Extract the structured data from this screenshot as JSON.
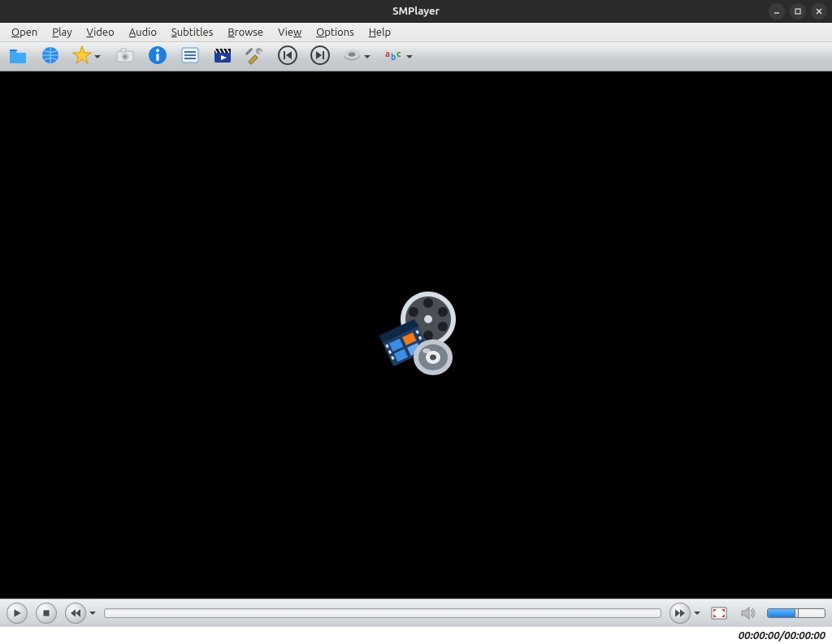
{
  "window": {
    "title": "SMPlayer"
  },
  "menu": {
    "items": [
      {
        "label": "Open",
        "mnemonic_index": 0
      },
      {
        "label": "Play",
        "mnemonic_index": 0
      },
      {
        "label": "Video",
        "mnemonic_index": 0
      },
      {
        "label": "Audio",
        "mnemonic_index": 0
      },
      {
        "label": "Subtitles",
        "mnemonic_index": 0
      },
      {
        "label": "Browse",
        "mnemonic_index": 0
      },
      {
        "label": "View",
        "mnemonic_index": 3
      },
      {
        "label": "Options",
        "mnemonic_index": 0
      },
      {
        "label": "Help",
        "mnemonic_index": 0
      }
    ]
  },
  "toolbar": {
    "buttons": [
      {
        "name": "open-file",
        "icon": "folder",
        "dropdown": false
      },
      {
        "name": "open-url",
        "icon": "globe",
        "dropdown": false
      },
      {
        "name": "favorites",
        "icon": "star",
        "dropdown": true
      },
      {
        "name": "screenshot",
        "icon": "camera",
        "dropdown": false
      },
      {
        "name": "media-info",
        "icon": "info",
        "dropdown": false
      },
      {
        "name": "show-playlist",
        "icon": "playlist",
        "dropdown": false
      },
      {
        "name": "youtube-browser",
        "icon": "clapboard",
        "dropdown": false
      },
      {
        "name": "preferences",
        "icon": "tools",
        "dropdown": false
      },
      {
        "name": "previous",
        "icon": "prev",
        "dropdown": false
      },
      {
        "name": "next",
        "icon": "next",
        "dropdown": false
      },
      {
        "name": "aspect-repeat",
        "icon": "loop",
        "dropdown": true
      },
      {
        "name": "subtitle-track",
        "icon": "abc",
        "dropdown": true
      }
    ]
  },
  "controls": {
    "play_name": "play-button",
    "stop_name": "stop-button",
    "rewind_name": "rewind-button",
    "forward_name": "forward-button",
    "fullscreen_name": "fullscreen-button",
    "mute_name": "mute-button",
    "volume_percent": 50
  },
  "status": {
    "time_current": "00:00:00",
    "time_total": "00:00:00",
    "separator": " / "
  }
}
